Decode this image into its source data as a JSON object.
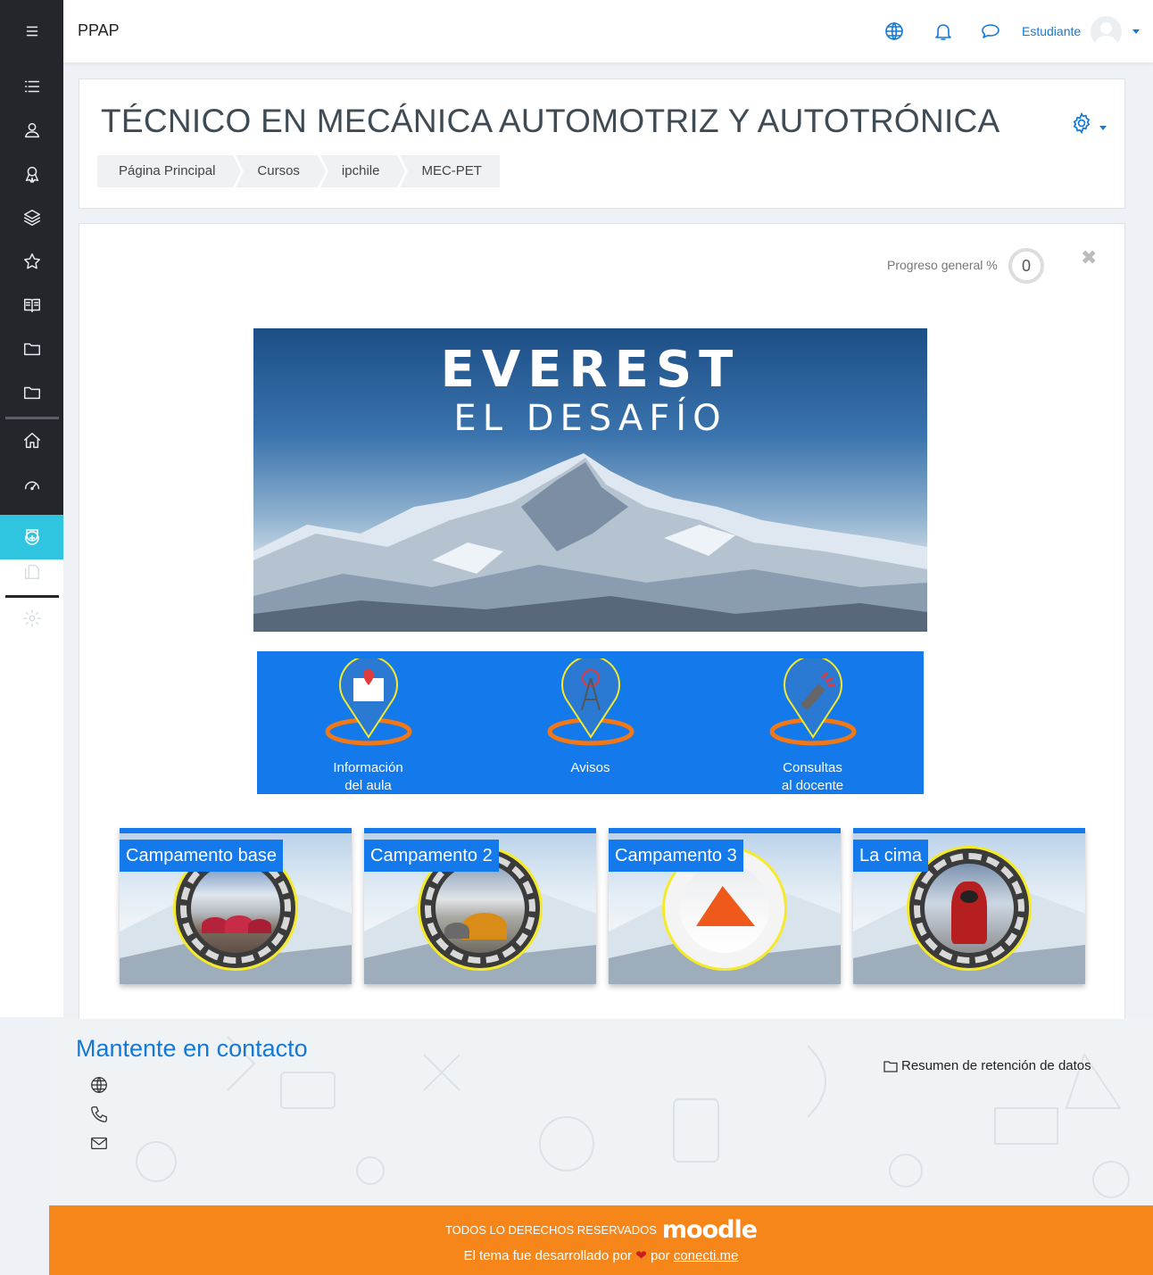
{
  "app": {
    "brand": "PPAP"
  },
  "topbar": {
    "icons": [
      "globe-icon",
      "bell-icon",
      "chat-icon"
    ],
    "user_name": "Estudiante"
  },
  "sidebar": {
    "items": [
      "menu-icon",
      "list-icon",
      "users-icon",
      "badge-icon",
      "layers-icon",
      "star-icon",
      "book-icon",
      "folder-icon",
      "folder-icon",
      "home-icon",
      "dashboard-icon",
      "course-icon",
      "files-icon",
      "gear-icon"
    ]
  },
  "course": {
    "title": "TÉCNICO EN MECÁNICA AUTOMOTRIZ Y AUTOTRÓNICA",
    "breadcrumb": [
      "Página Principal",
      "Cursos",
      "ipchile",
      "MEC-PET"
    ]
  },
  "progress": {
    "label": "Progreso general %",
    "value": "0"
  },
  "banner": {
    "title": "EVEREST",
    "subtitle": "EL DESAFÍO"
  },
  "nav": [
    {
      "line1": "Información",
      "line2": "del aula"
    },
    {
      "line1": "Avisos",
      "line2": ""
    },
    {
      "line1": "Consultas",
      "line2": "al docente"
    }
  ],
  "camps": [
    {
      "label": "Campamento base"
    },
    {
      "label": "Campamento 2"
    },
    {
      "label": "Campamento 3"
    },
    {
      "label": "La cima"
    }
  ],
  "footer": {
    "contact_title": "Mantente en contacto",
    "retention": "Resumen de retención de datos",
    "rights": "TODOS LO DERECHOS RESERVADOS",
    "moodle": "moodle",
    "credit_pre": "El tema fue desarrollado por",
    "credit_mid": "por",
    "credit_link": "conecti.me"
  },
  "colors": {
    "accent": "#1479ea",
    "sidebar": "#23272c",
    "active": "#2fc4e0",
    "footer": "#f6861a"
  }
}
